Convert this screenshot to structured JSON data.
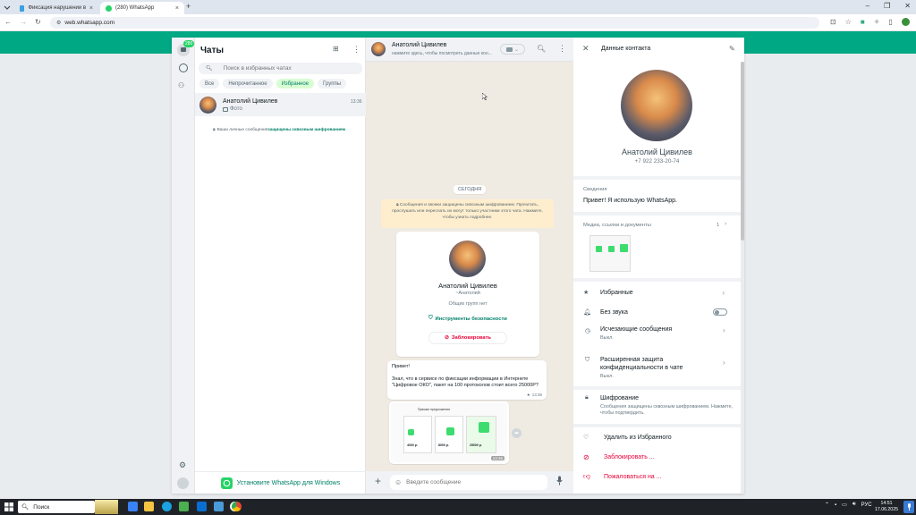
{
  "browser": {
    "tabs": [
      {
        "title": "Фиксация нарушений в интер"
      },
      {
        "title": "(280) WhatsApp"
      }
    ],
    "url": "web.whatsapp.com"
  },
  "nav": {
    "badge": "280"
  },
  "chatlist": {
    "title": "Чаты",
    "search_placeholder": "Поиск в избранных чатах",
    "filters": [
      "Все",
      "Непрочитанное",
      "Избранное",
      "Группы"
    ],
    "chats": [
      {
        "name": "Анатолий Цивилев",
        "time": "13:36",
        "preview": "Фото"
      }
    ],
    "encryption_note_prefix": "Ваши личные сообщения ",
    "encryption_note_link": "защищены сквозным шифрованием",
    "install_text": "Установите WhatsApp для Windows"
  },
  "conversation": {
    "contact_name": "Анатолий Цивилев",
    "subtitle": "нажмите здесь, чтобы посмотреть данные кон...",
    "date_chip": "СЕГОДНЯ",
    "system_message": "Сообщения и звонки защищены сквозным шифрованием. Прочитать, прослушать или переслать их могут только участники этого чата. Нажмите, чтобы узнать подробнее.",
    "contact_card": {
      "name": "Анатолий Цивилев",
      "alias": "~Анатолий",
      "groups": "Общих групп нет",
      "security": "Инструменты безопасности",
      "block": "Заблокировать"
    },
    "message": {
      "line1": "Привет!",
      "line2": "Знал, что в сервисе по фиксации информации в Интернете \"Цифровое ОКО\", пакет на 100 протоколов стоит всего 25000Р?",
      "time": "13:36"
    },
    "image_time": "13:36",
    "image_title": "Прямые предложения",
    "image_prices": [
      "4000 р.",
      "8000 р.",
      "25000 р."
    ],
    "composer_placeholder": "Введите сообщение"
  },
  "contact_panel": {
    "header": "Данные контакта",
    "name": "Анатолий Цивилев",
    "phone": "+7 922 233-20-74",
    "about_label": "Сведения",
    "about_text": "Привет! Я использую WhatsApp.",
    "media_label": "Медиа, ссылки и документы",
    "media_count": "1",
    "favorites": "Избранные",
    "mute": "Без звука",
    "disappearing": "Исчезающие сообщения",
    "disappearing_sub": "Выкл.",
    "privacy": "Расширенная защита конфиденциальности в чате",
    "privacy_sub": "Выкл.",
    "encryption": "Шифрование",
    "encryption_sub": "Сообщения защищены сквозным шифрованием. Нажмите, чтобы подтвердить.",
    "remove_fav": "Удалить из Избранного",
    "block": "Заблокировать ...",
    "report": "Пожаловаться на ..."
  },
  "taskbar": {
    "search": "Поиск",
    "lang": "РУС",
    "time": "14:51",
    "date": "17.06.2025"
  },
  "colors": {
    "brand": "#00a884",
    "danger": "#ea0038",
    "bubble_in": "#ffffff",
    "system_bg": "#ffeecd"
  }
}
